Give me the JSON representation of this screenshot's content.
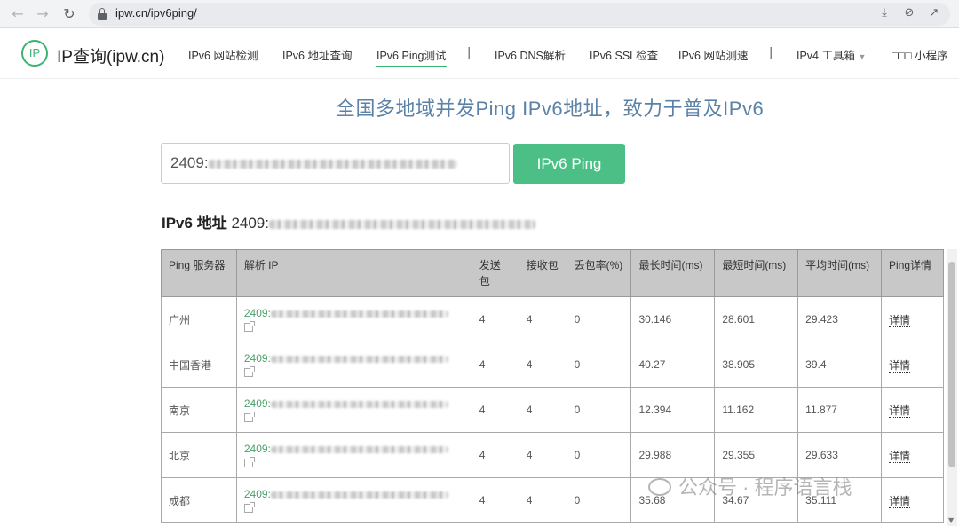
{
  "browser": {
    "url": "ipw.cn/ipv6ping/",
    "back_icon": "arrow-left-icon",
    "forward_icon": "arrow-right-icon",
    "reload_icon": "reload-icon"
  },
  "site": {
    "logo_mark": "IP",
    "logo_text": "IP查询(ipw.cn)",
    "nav": [
      {
        "label": "IPv6 网站检测"
      },
      {
        "label": "IPv6 地址查询"
      },
      {
        "label": "IPv6 Ping测试"
      },
      {
        "label": "IPv6 DNS解析"
      },
      {
        "label": "IPv6 SSL检查"
      },
      {
        "label": "IPv6 网站测速"
      },
      {
        "label": "IPv4 工具箱"
      },
      {
        "label": "□□□ 小程序"
      }
    ],
    "separator": "|",
    "caret": "▼"
  },
  "main": {
    "title": "全国多地域并发Ping IPv6地址，致力于普及IPv6",
    "input_prefix": "2409:",
    "button_label": "IPv6 Ping",
    "address_label": "IPv6 地址",
    "address_prefix": "2409:"
  },
  "table": {
    "headers": [
      "Ping 服务器",
      "解析 IP",
      "发送包",
      "接收包",
      "丢包率(%)",
      "最长时间(ms)",
      "最短时间(ms)",
      "平均时间(ms)",
      "Ping详情"
    ],
    "rows": [
      {
        "server": "广州",
        "ip_prefix": "2409:",
        "sent": "4",
        "received": "4",
        "loss": "0",
        "max": "30.146",
        "min": "28.601",
        "avg": "29.423",
        "detail": "详情"
      },
      {
        "server": "中国香港",
        "ip_prefix": "2409:",
        "sent": "4",
        "received": "4",
        "loss": "0",
        "max": "40.27",
        "min": "38.905",
        "avg": "39.4",
        "detail": "详情"
      },
      {
        "server": "南京",
        "ip_prefix": "2409:",
        "sent": "4",
        "received": "4",
        "loss": "0",
        "max": "12.394",
        "min": "11.162",
        "avg": "11.877",
        "detail": "详情"
      },
      {
        "server": "北京",
        "ip_prefix": "2409:",
        "sent": "4",
        "received": "4",
        "loss": "0",
        "max": "29.988",
        "min": "29.355",
        "avg": "29.633",
        "detail": "详情"
      },
      {
        "server": "成都",
        "ip_prefix": "2409:",
        "sent": "4",
        "received": "4",
        "loss": "0",
        "max": "35.68",
        "min": "34.67",
        "avg": "35.111",
        "detail": "详情"
      }
    ]
  },
  "watermark": "公众号 · 程序语言栈"
}
